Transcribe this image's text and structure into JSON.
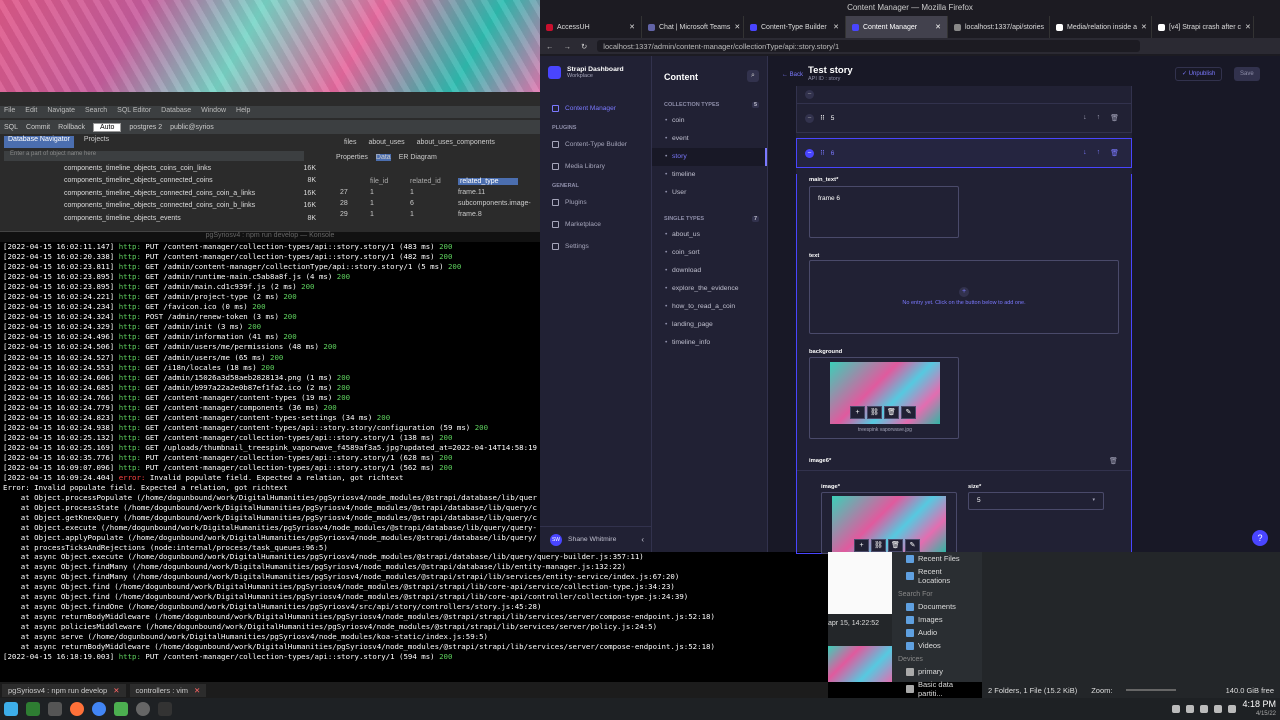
{
  "firefox": {
    "title": "Content Manager — Mozilla Firefox",
    "tabs": [
      {
        "label": "AccessUH",
        "color": "#c8102e",
        "active": false
      },
      {
        "label": "Chat | Microsoft Teams",
        "color": "#6264a7",
        "active": false
      },
      {
        "label": "Content-Type Builder",
        "color": "#4945ff",
        "active": false
      },
      {
        "label": "Content Manager",
        "color": "#4945ff",
        "active": true
      },
      {
        "label": "localhost:1337/api/stories",
        "color": "#888888",
        "active": false
      },
      {
        "label": "Media/relation inside a",
        "color": "#ffffff",
        "active": false
      },
      {
        "label": "[v4] Strapi crash after c",
        "color": "#ffffff",
        "active": false
      }
    ],
    "url": "localhost:1337/admin/content-manager/collectionType/api::story.story/1"
  },
  "strapi": {
    "brand_title": "Strapi Dashboard",
    "brand_sub": "Workplace",
    "menu": {
      "content_manager": "Content Manager",
      "plugins_head": "PLUGINS",
      "ctb": "Content-Type Builder",
      "media": "Media Library",
      "general_head": "GENERAL",
      "plugins": "Plugins",
      "marketplace": "Marketplace",
      "settings": "Settings"
    },
    "user": {
      "initials": "SW",
      "name": "Shane Whitmire"
    },
    "content_title": "Content",
    "collection_head": "COLLECTION TYPES",
    "collection_count": "5",
    "collection_types": [
      "coin",
      "event",
      "story",
      "timeline",
      "User"
    ],
    "single_head": "SINGLE TYPES",
    "single_count": "7",
    "single_types": [
      "about_us",
      "coin_sort",
      "download",
      "explore_the_evidence",
      "how_to_read_a_coin",
      "landing_page",
      "timeline_info"
    ],
    "header": {
      "back": "Back",
      "title": "Test story",
      "sub": "API ID : story",
      "unpublish": "Unpublish",
      "save": "Save"
    },
    "rows": [
      {
        "num": "5"
      },
      {
        "num": "6"
      }
    ],
    "fields": {
      "main_text_label": "main_text*",
      "main_text_value": "frame 6",
      "text_label": "text",
      "text_empty": "No entry yet. Click on the button below to add one.",
      "background_label": "background",
      "background_file": "treespink vaporwave.jpg",
      "image6_label": "image6*",
      "image_label": "image*",
      "size_label": "size*",
      "size_value": "5"
    }
  },
  "dbeaver": {
    "menu": [
      "File",
      "Edit",
      "Navigate",
      "Search",
      "SQL Editor",
      "Database",
      "Window",
      "Help"
    ],
    "auto": "Auto",
    "db": "postgres 2",
    "schema": "public@syrios",
    "nav_tabs": [
      "Database Navigator",
      "Projects"
    ],
    "filter_placeholder": "Enter a part of object name here",
    "tree": [
      {
        "name": "components_timeline_objects_coins_coin_links",
        "size": "16K"
      },
      {
        "name": "components_timeline_objects_connected_coins",
        "size": "8K"
      },
      {
        "name": "components_timeline_objects_connected_coins_coin_a_links",
        "size": "16K"
      },
      {
        "name": "components_timeline_objects_connected_coins_coin_b_links",
        "size": "16K"
      },
      {
        "name": "components_timeline_objects_events",
        "size": "8K"
      }
    ],
    "editor_tabs": [
      "files",
      "about_uses",
      "about_uses_components"
    ],
    "prop_tabs": [
      "Properties",
      "Data",
      "ER Diagram"
    ],
    "columns": [
      "file_id",
      "related_id",
      "related_type"
    ],
    "rows": [
      {
        "n": "27",
        "a": "1",
        "b": "1",
        "c": "frame.11"
      },
      {
        "n": "28",
        "a": "1",
        "b": "6",
        "c": "subcomponents.image-"
      },
      {
        "n": "29",
        "a": "1",
        "b": "1",
        "c": "frame.8"
      }
    ]
  },
  "console": {
    "title": "pgSyriosv4 : npm run develop — Konsole",
    "lines": [
      {
        "t": "[2022-04-15 16:02:11.147] ",
        "g": "http: ",
        "m": "PUT /content-manager/collection-types/api::story.story/1 (483 ms) ",
        "s": "200"
      },
      {
        "t": "[2022-04-15 16:02:20.338] ",
        "g": "http: ",
        "m": "PUT /content-manager/collection-types/api::story.story/1 (482 ms) ",
        "s": "200"
      },
      {
        "t": "[2022-04-15 16:02:23.811] ",
        "g": "http: ",
        "m": "GET /admin/content-manager/collectionType/api::story.story/1 (5 ms) ",
        "s": "200"
      },
      {
        "t": "[2022-04-15 16:02:23.895] ",
        "g": "http: ",
        "m": "GET /admin/runtime-main.c5ab8a8f.js (4 ms) ",
        "s": "200"
      },
      {
        "t": "[2022-04-15 16:02:23.895] ",
        "g": "http: ",
        "m": "GET /admin/main.cd1c939f.js (2 ms) ",
        "s": "200"
      },
      {
        "t": "[2022-04-15 16:02:24.221] ",
        "g": "http: ",
        "m": "GET /admin/project-type (2 ms) ",
        "s": "200"
      },
      {
        "t": "[2022-04-15 16:02:24.234] ",
        "g": "http: ",
        "m": "GET /favicon.ico (0 ms) ",
        "s": "200"
      },
      {
        "t": "[2022-04-15 16:02:24.324] ",
        "g": "http: ",
        "m": "POST /admin/renew-token (3 ms) ",
        "s": "200"
      },
      {
        "t": "[2022-04-15 16:02:24.329] ",
        "g": "http: ",
        "m": "GET /admin/init (3 ms) ",
        "s": "200"
      },
      {
        "t": "[2022-04-15 16:02:24.496] ",
        "g": "http: ",
        "m": "GET /admin/information (41 ms) ",
        "s": "200"
      },
      {
        "t": "[2022-04-15 16:02:24.506] ",
        "g": "http: ",
        "m": "GET /admin/users/me/permissions (48 ms) ",
        "s": "200"
      },
      {
        "t": "[2022-04-15 16:02:24.527] ",
        "g": "http: ",
        "m": "GET /admin/users/me (65 ms) ",
        "s": "200"
      },
      {
        "t": "[2022-04-15 16:02:24.553] ",
        "g": "http: ",
        "m": "GET /i18n/locales (18 ms) ",
        "s": "200"
      },
      {
        "t": "[2022-04-15 16:02:24.606] ",
        "g": "http: ",
        "m": "GET /admin/15026a3d58aeb2828134.png (1 ms) ",
        "s": "200"
      },
      {
        "t": "[2022-04-15 16:02:24.685] ",
        "g": "http: ",
        "m": "GET /admin/b997a22a2e0b87ef1fa2.ico (2 ms) ",
        "s": "200"
      },
      {
        "t": "[2022-04-15 16:02:24.766] ",
        "g": "http: ",
        "m": "GET /content-manager/content-types (19 ms) ",
        "s": "200"
      },
      {
        "t": "[2022-04-15 16:02:24.779] ",
        "g": "http: ",
        "m": "GET /content-manager/components (36 ms) ",
        "s": "200"
      },
      {
        "t": "[2022-04-15 16:02:24.823] ",
        "g": "http: ",
        "m": "GET /content-manager/content-types-settings (34 ms) ",
        "s": "200"
      },
      {
        "t": "[2022-04-15 16:02:24.938] ",
        "g": "http: ",
        "m": "GET /content-manager/content-types/api::story.story/configuration (59 ms) ",
        "s": "200"
      },
      {
        "t": "[2022-04-15 16:02:25.132] ",
        "g": "http: ",
        "m": "GET /content-manager/collection-types/api::story.story/1 (138 ms) ",
        "s": "200"
      },
      {
        "t": "[2022-04-15 16:02:25.169] ",
        "g": "http: ",
        "m": "GET /uploads/thumbnail_treespink_vaporwave_f4589af3a5.jpg?updated_at=2022-04-14T14:58:19",
        "s": ""
      },
      {
        "t": "[2022-04-15 16:02:35.776] ",
        "g": "http: ",
        "m": "PUT /content-manager/collection-types/api::story.story/1 (628 ms) ",
        "s": "200"
      },
      {
        "t": "[2022-04-15 16:09:07.096] ",
        "g": "http: ",
        "m": "PUT /content-manager/collection-types/api::story.story/1 (562 ms) ",
        "s": "200"
      },
      {
        "t": "[2022-04-15 16:09:24.404] ",
        "r": "error: ",
        "m": "Invalid populate field. Expected a relation, got richtext",
        "s": ""
      }
    ],
    "stack": [
      "Error: Invalid populate field. Expected a relation, got richtext",
      "    at Object.processPopulate (/home/dogunbound/work/DigitalHumanities/pgSyriosv4/node_modules/@strapi/database/lib/quer",
      "    at Object.processState (/home/dogunbound/work/DigitalHumanities/pgSyriosv4/node_modules/@strapi/database/lib/query/c",
      "    at Object.getKnexQuery (/home/dogunbound/work/DigitalHumanities/pgSyriosv4/node_modules/@strapi/database/lib/query/c",
      "    at Object.execute (/home/dogunbound/work/DigitalHumanities/pgSyriosv4/node_modules/@strapi/database/lib/query/query-",
      "    at Object.applyPopulate (/home/dogunbound/work/DigitalHumanities/pgSyriosv4/node_modules/@strapi/database/lib/query/",
      "    at processTicksAndRejections (node:internal/process/task_queues:96:5)"
    ],
    "stack_wide": [
      "    at async Object.execute (/home/dogunbound/work/DigitalHumanities/pgSyriosv4/node_modules/@strapi/database/lib/query/query-builder.js:357:11)",
      "    at async Object.findMany (/home/dogunbound/work/DigitalHumanities/pgSyriosv4/node_modules/@strapi/database/lib/entity-manager.js:132:22)",
      "    at async Object.findMany (/home/dogunbound/work/DigitalHumanities/pgSyriosv4/node_modules/@strapi/strapi/lib/services/entity-service/index.js:67:20)",
      "    at async Object.find (/home/dogunbound/work/DigitalHumanities/pgSyriosv4/node_modules/@strapi/strapi/lib/core-api/service/collection-type.js:34:23)",
      "    at async Object.find (/home/dogunbound/work/DigitalHumanities/pgSyriosv4/node_modules/@strapi/strapi/lib/core-api/controller/collection-type.js:24:39)",
      "    at async Object.findOne (/home/dogunbound/work/DigitalHumanities/pgSyriosv4/src/api/story/controllers/story.js:45:28)",
      "    at async returnBodyMiddleware (/home/dogunbound/work/DigitalHumanities/pgSyriosv4/node_modules/@strapi/strapi/lib/services/server/compose-endpoint.js:52:18)",
      "    at async policiesMiddleware (/home/dogunbound/work/DigitalHumanities/pgSyriosv4/node_modules/@strapi/strapi/lib/services/server/policy.js:24:5)",
      "    at async serve (/home/dogunbound/work/DigitalHumanities/pgSyriosv4/node_modules/koa-static/index.js:59:5)",
      "    at async returnBodyMiddleware (/home/dogunbound/work/DigitalHumanities/pgSyriosv4/node_modules/@strapi/strapi/lib/services/server/compose-endpoint.js:52:18)"
    ],
    "last": {
      "t": "[2022-04-15 16:18:19.003] ",
      "g": "http: ",
      "m": "PUT /content-manager/collection-types/api::story.story/1 (594 ms) ",
      "s": "200"
    },
    "tabs": [
      "pgSyriosv4 : npm run develop",
      "controllers : vim"
    ]
  },
  "filemanager": {
    "date": "apr 15, 14:22:52",
    "recent_files": "Recent Files",
    "recent_locations": "Recent Locations",
    "search_for": "Search For",
    "places": [
      "Documents",
      "Images",
      "Audio",
      "Videos"
    ],
    "devices_head": "Devices",
    "devices": [
      "primary",
      "Basic data partiti..."
    ],
    "status": "2 Folders, 1 File (15.2 KiB)",
    "zoom": "Zoom:",
    "free": "140.0 GiB free"
  },
  "clock": {
    "time": "4:18 PM",
    "date": "4/15/22"
  }
}
